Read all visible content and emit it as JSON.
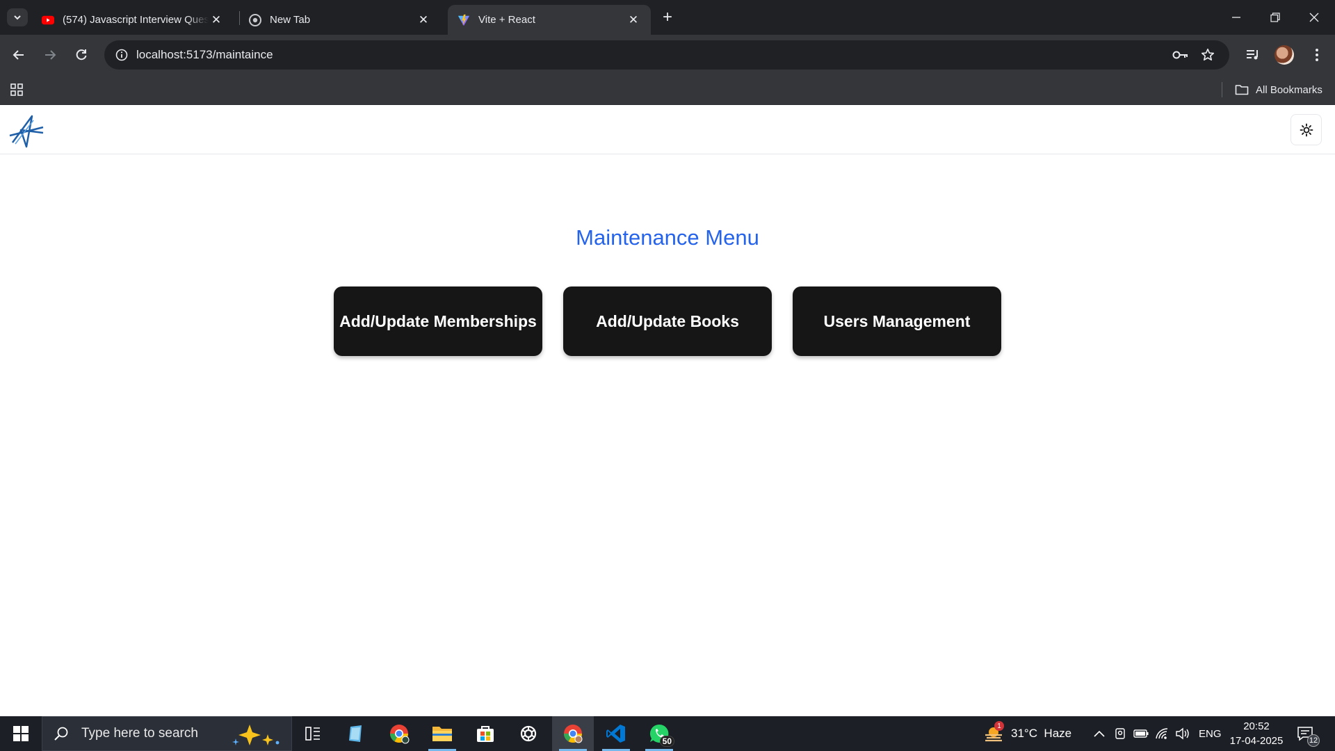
{
  "browser": {
    "tabs": [
      {
        "title": "(574) Javascript Interview Quest",
        "icon": "youtube-icon",
        "active": false
      },
      {
        "title": "New Tab",
        "icon": "chrome-icon",
        "active": false
      },
      {
        "title": "Vite + React",
        "icon": "vite-icon",
        "active": true
      }
    ],
    "url": "localhost:5173/maintaince",
    "bookmarks_label": "All Bookmarks"
  },
  "page": {
    "title": "Maintenance Menu",
    "buttons": [
      {
        "label": "Add/Update Memberships"
      },
      {
        "label": "Add/Update Books"
      },
      {
        "label": "Users Management"
      }
    ],
    "accent_color": "#2563eb",
    "button_color": "#161616"
  },
  "taskbar": {
    "search_placeholder": "Type here to search",
    "weather": "31°C  Haze",
    "weather_badge": "1",
    "whatsapp_badge": "50",
    "language": "ENG",
    "time": "20:52",
    "date": "17-04-2025",
    "notification_count": "12"
  }
}
